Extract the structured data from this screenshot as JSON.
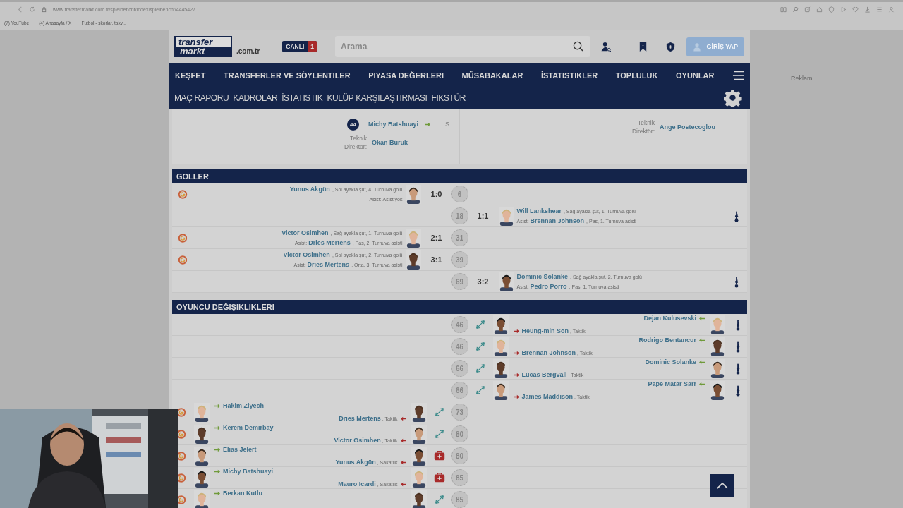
{
  "browser": {
    "url": "www.transfermarkt.com.tr/spielbericht/index/spielbericht/4445427",
    "bookmarks": [
      "(7) YouTube",
      "(4) Anasayfa / X",
      "Futbol - skorlar, takv..."
    ]
  },
  "header": {
    "logo_top": "transfer",
    "logo_bottom": "markt",
    "domain": ".com.tr",
    "live_label": "CANLI",
    "live_count": "1",
    "search": {
      "placeholder": "Arama"
    },
    "login": "GİRİŞ YAP"
  },
  "nav": [
    "KEŞFET",
    "TRANSFERLER VE SÖYLENTILER",
    "PIYASA DEĞERLERI",
    "MÜSABAKALAR",
    "İSTATISTIKLER",
    "TOPLULUK",
    "OYUNLAR"
  ],
  "subnav": [
    "MAÇ RAPORU",
    "KADROLAR",
    "İSTATISTIK",
    "KULÜP KARŞILAŞTIRMASI",
    "FIKSTÜR"
  ],
  "ad_label": "Reklam",
  "lineup": {
    "home": {
      "number": "44",
      "name": "Michy Batshuayi",
      "position": "S",
      "coach_label": "Teknik Direktör:",
      "coach": "Okan Buruk"
    },
    "away": {
      "coach_label": "Teknik Direktör:",
      "coach": "Ange Postecoglou"
    }
  },
  "goals": {
    "title": "GOLLER",
    "items": [
      {
        "away": false,
        "scorer": "Yunus Akgün",
        "detail": ", Sol ayakla şut, 4. Turnuva golü",
        "assist_label": "Asist:",
        "assist_detail": "Asist yok",
        "score": "1:0",
        "minute": "6"
      },
      {
        "away": true,
        "scorer": "Will Lankshear",
        "detail": ", Sağ ayakla şut, 1. Turnuva golü",
        "assist_label": "Asist:",
        "assist": "Brennan Johnson",
        "assist_detail": ", Pas, 1. Turnuva asisti",
        "score": "1:1",
        "minute": "18"
      },
      {
        "away": false,
        "scorer": "Victor Osimhen",
        "detail": ", Sağ ayakla şut, 1. Turnuva golü",
        "assist_label": "Asist:",
        "assist": "Dries Mertens",
        "assist_detail": ", Pas, 2. Turnuva asisti",
        "score": "2:1",
        "minute": "31"
      },
      {
        "away": false,
        "scorer": "Victor Osimhen",
        "detail": ", Sol ayakla şut, 2. Turnuva golü",
        "assist_label": "Asist:",
        "assist": "Dries Mertens",
        "assist_detail": ", Orta, 3. Turnuva asisti",
        "score": "3:1",
        "minute": "39"
      },
      {
        "away": true,
        "scorer": "Dominic Solanke",
        "detail": ", Sağ ayakla şut, 2. Turnuva golü",
        "assist_label": "Asist:",
        "assist": "Pedro Porro",
        "assist_detail": ", Pas, 1. Turnuva asisti",
        "score": "3:2",
        "minute": "69"
      }
    ]
  },
  "substitutions": {
    "title": "OYUNCU DEĞIŞIKLIKLERI",
    "items": [
      {
        "away": true,
        "kind": "tactic",
        "minute": "46",
        "player_in": "Dejan Kulusevski",
        "player_out": "Heung-min Son",
        "reason": ", Taktik"
      },
      {
        "away": true,
        "kind": "tactic",
        "minute": "46",
        "player_in": "Rodrigo Bentancur",
        "player_out": "Brennan Johnson",
        "reason": ", Taktik"
      },
      {
        "away": true,
        "kind": "tactic",
        "minute": "66",
        "player_in": "Dominic Solanke",
        "player_out": "Lucas Bergvall",
        "reason": ", Taktik"
      },
      {
        "away": true,
        "kind": "tactic",
        "minute": "66",
        "player_in": "Pape Matar Sarr",
        "player_out": "James Maddison",
        "reason": ", Taktik"
      },
      {
        "away": false,
        "kind": "tactic",
        "minute": "73",
        "player_in": "Hakim Ziyech",
        "player_out": "Dries Mertens",
        "reason": ", Taktik"
      },
      {
        "away": false,
        "kind": "tactic",
        "minute": "80",
        "player_in": "Kerem Demirbay",
        "player_out": "Victor Osimhen",
        "reason": ", Taktik"
      },
      {
        "away": false,
        "kind": "injury",
        "minute": "80",
        "player_in": "Elias Jelert",
        "player_out": "Yunus Akgün",
        "reason": ", Sakatlık"
      },
      {
        "away": false,
        "kind": "injury",
        "minute": "85",
        "player_in": "Michy Batshuayi",
        "player_out": "Mauro Icardi",
        "reason": ", Sakatlık"
      },
      {
        "away": false,
        "kind": "tactic",
        "minute": "85",
        "player_in": "Berkan Kutlu"
      }
    ]
  }
}
